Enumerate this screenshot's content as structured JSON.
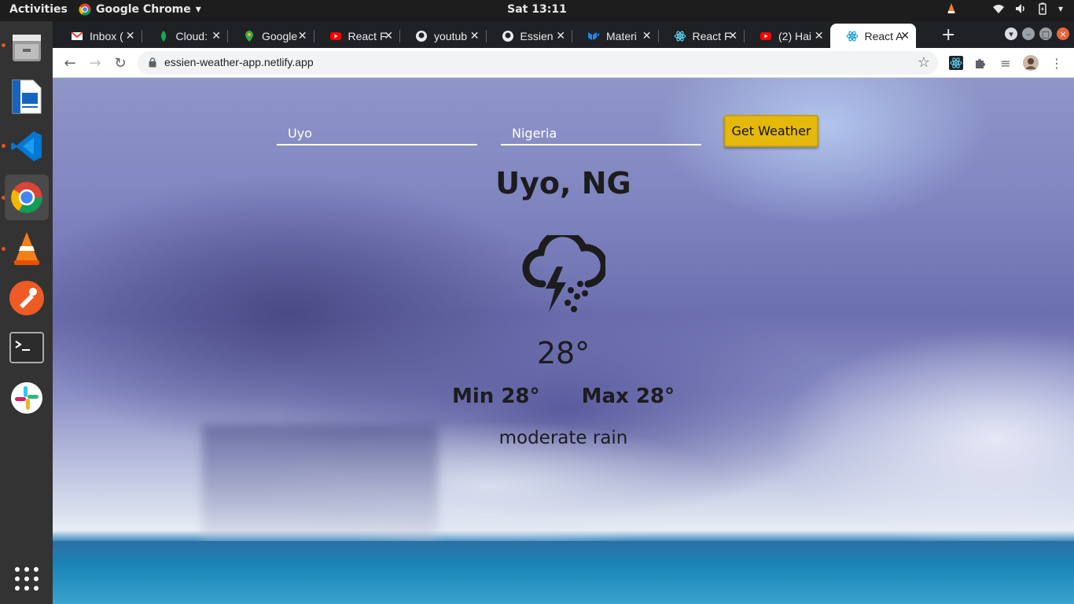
{
  "topbar": {
    "activities": "Activities",
    "app_name": "Google Chrome",
    "clock": "Sat 13:11"
  },
  "dock": {
    "items": [
      "files-icon",
      "writer-icon",
      "vscode-icon",
      "chrome-icon",
      "vlc-icon",
      "postman-icon",
      "terminal-icon",
      "slack-icon",
      "app-grid-icon"
    ]
  },
  "browser": {
    "tabs": [
      {
        "title": "Inbox (",
        "icon": "gmail-icon",
        "color": "#ea4335"
      },
      {
        "title": "Cloud:",
        "icon": "mongodb-leaf-icon",
        "color": "#13aa52"
      },
      {
        "title": "Google",
        "icon": "google-maps-icon",
        "color": "#34a853"
      },
      {
        "title": "React F",
        "icon": "youtube-icon",
        "color": "#ff0000"
      },
      {
        "title": "youtub",
        "icon": "github-icon",
        "color": "#e8eaed"
      },
      {
        "title": "Essien",
        "icon": "github-icon",
        "color": "#e8eaed"
      },
      {
        "title": "Materi",
        "icon": "material-ui-icon",
        "color": "#1e88e5"
      },
      {
        "title": "React F",
        "icon": "react-icon",
        "color": "#61dafb"
      },
      {
        "title": "(2) Hai",
        "icon": "youtube-icon",
        "color": "#ff0000"
      },
      {
        "title": "React A",
        "icon": "react-icon",
        "color": "#61dafb",
        "active": true
      }
    ],
    "url": "essien-weather-app.netlify.app"
  },
  "app": {
    "city_placeholder": "Uyo",
    "country_placeholder": "Nigeria",
    "button_label": "Get Weather",
    "location": "Uyo, NG",
    "temperature": "28°",
    "min": "Min 28°",
    "max": "Max 28°",
    "description": "moderate rain",
    "weather_icon": "thunderstorm-rain-icon",
    "button_color": "#e4b90c"
  }
}
